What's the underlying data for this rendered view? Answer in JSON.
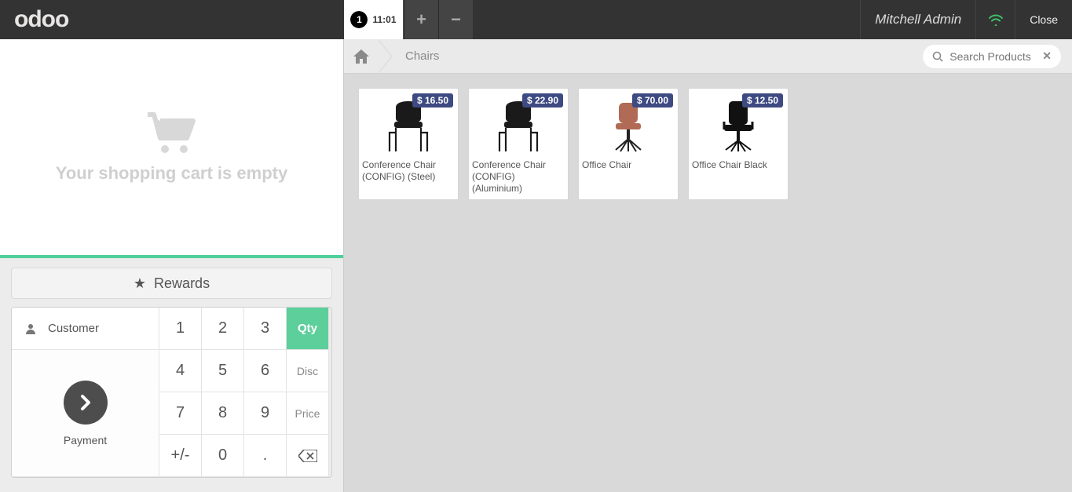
{
  "topbar": {
    "logo": "odoo",
    "order_badge": "1",
    "order_time": "11:01",
    "plus": "+",
    "minus": "−",
    "user": "Mitchell Admin",
    "close": "Close"
  },
  "cart": {
    "empty_text": "Your shopping cart is empty"
  },
  "controls": {
    "rewards": "Rewards",
    "customer": "Customer",
    "payment": "Payment",
    "qty": "Qty",
    "disc": "Disc",
    "price": "Price",
    "k1": "1",
    "k2": "2",
    "k3": "3",
    "k4": "4",
    "k5": "5",
    "k6": "6",
    "k7": "7",
    "k8": "8",
    "k9": "9",
    "pm": "+/-",
    "k0": "0",
    "dot": "."
  },
  "breadcrumb": {
    "home": "home",
    "category": "Chairs"
  },
  "search": {
    "placeholder": "Search Products"
  },
  "products": [
    {
      "name": "Conference Chair (CONFIG) (Steel)",
      "price": "$ 16.50",
      "variant": "steel"
    },
    {
      "name": "Conference Chair (CONFIG) (Aluminium)",
      "price": "$ 22.90",
      "variant": "steel"
    },
    {
      "name": "Office Chair",
      "price": "$ 70.00",
      "variant": "office-orange"
    },
    {
      "name": "Office Chair Black",
      "price": "$ 12.50",
      "variant": "office-black"
    }
  ]
}
